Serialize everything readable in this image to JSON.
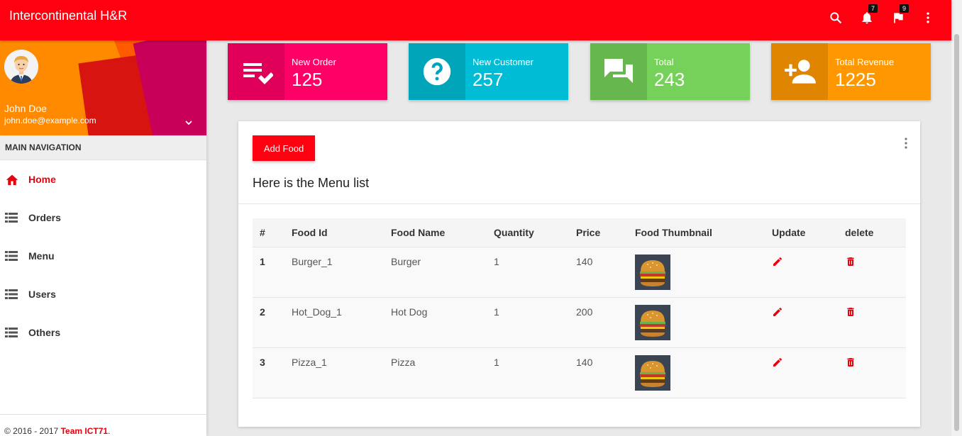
{
  "app": {
    "title": "Intercontinental H&R",
    "notifications_count": "7",
    "tasks_count": "9",
    "accent_color": "#ff0010"
  },
  "user": {
    "name": "John Doe",
    "email": "john.doe@example.com"
  },
  "sidebar": {
    "header": "MAIN NAVIGATION",
    "items": [
      {
        "label": "Home",
        "icon": "home-icon",
        "active": true
      },
      {
        "label": "Orders",
        "icon": "list-icon"
      },
      {
        "label": "Menu",
        "icon": "list-icon"
      },
      {
        "label": "Users",
        "icon": "list-icon"
      },
      {
        "label": "Others",
        "icon": "list-icon"
      }
    ],
    "legal_prefix": "© 2016 - 2017 ",
    "legal_team": "Team ICT71",
    "legal_suffix": "."
  },
  "stats": [
    {
      "label": "New Order",
      "value": "125",
      "color": "#ff0066",
      "icon": "playlist-check-icon"
    },
    {
      "label": "New Customer",
      "value": "257",
      "color": "#00bcd4",
      "icon": "help-icon"
    },
    {
      "label": "Total",
      "value": "243",
      "color": "#76d15a",
      "icon": "forum-icon"
    },
    {
      "label": "Total Revenue",
      "value": "1225",
      "color": "#ff9800",
      "icon": "person-add-icon"
    }
  ],
  "menu_card": {
    "add_button": "Add Food",
    "title": "Here is the Menu list",
    "columns": [
      "#",
      "Food Id",
      "Food Name",
      "Quantity",
      "Price",
      "Food Thumbnail",
      "Update",
      "delete"
    ],
    "rows": [
      {
        "num": "1",
        "id": "Burger_1",
        "name": "Burger",
        "qty": "1",
        "price": "140"
      },
      {
        "num": "2",
        "id": "Hot_Dog_1",
        "name": "Hot Dog",
        "qty": "1",
        "price": "200"
      },
      {
        "num": "3",
        "id": "Pizza_1",
        "name": "Pizza",
        "qty": "1",
        "price": "140"
      }
    ]
  }
}
